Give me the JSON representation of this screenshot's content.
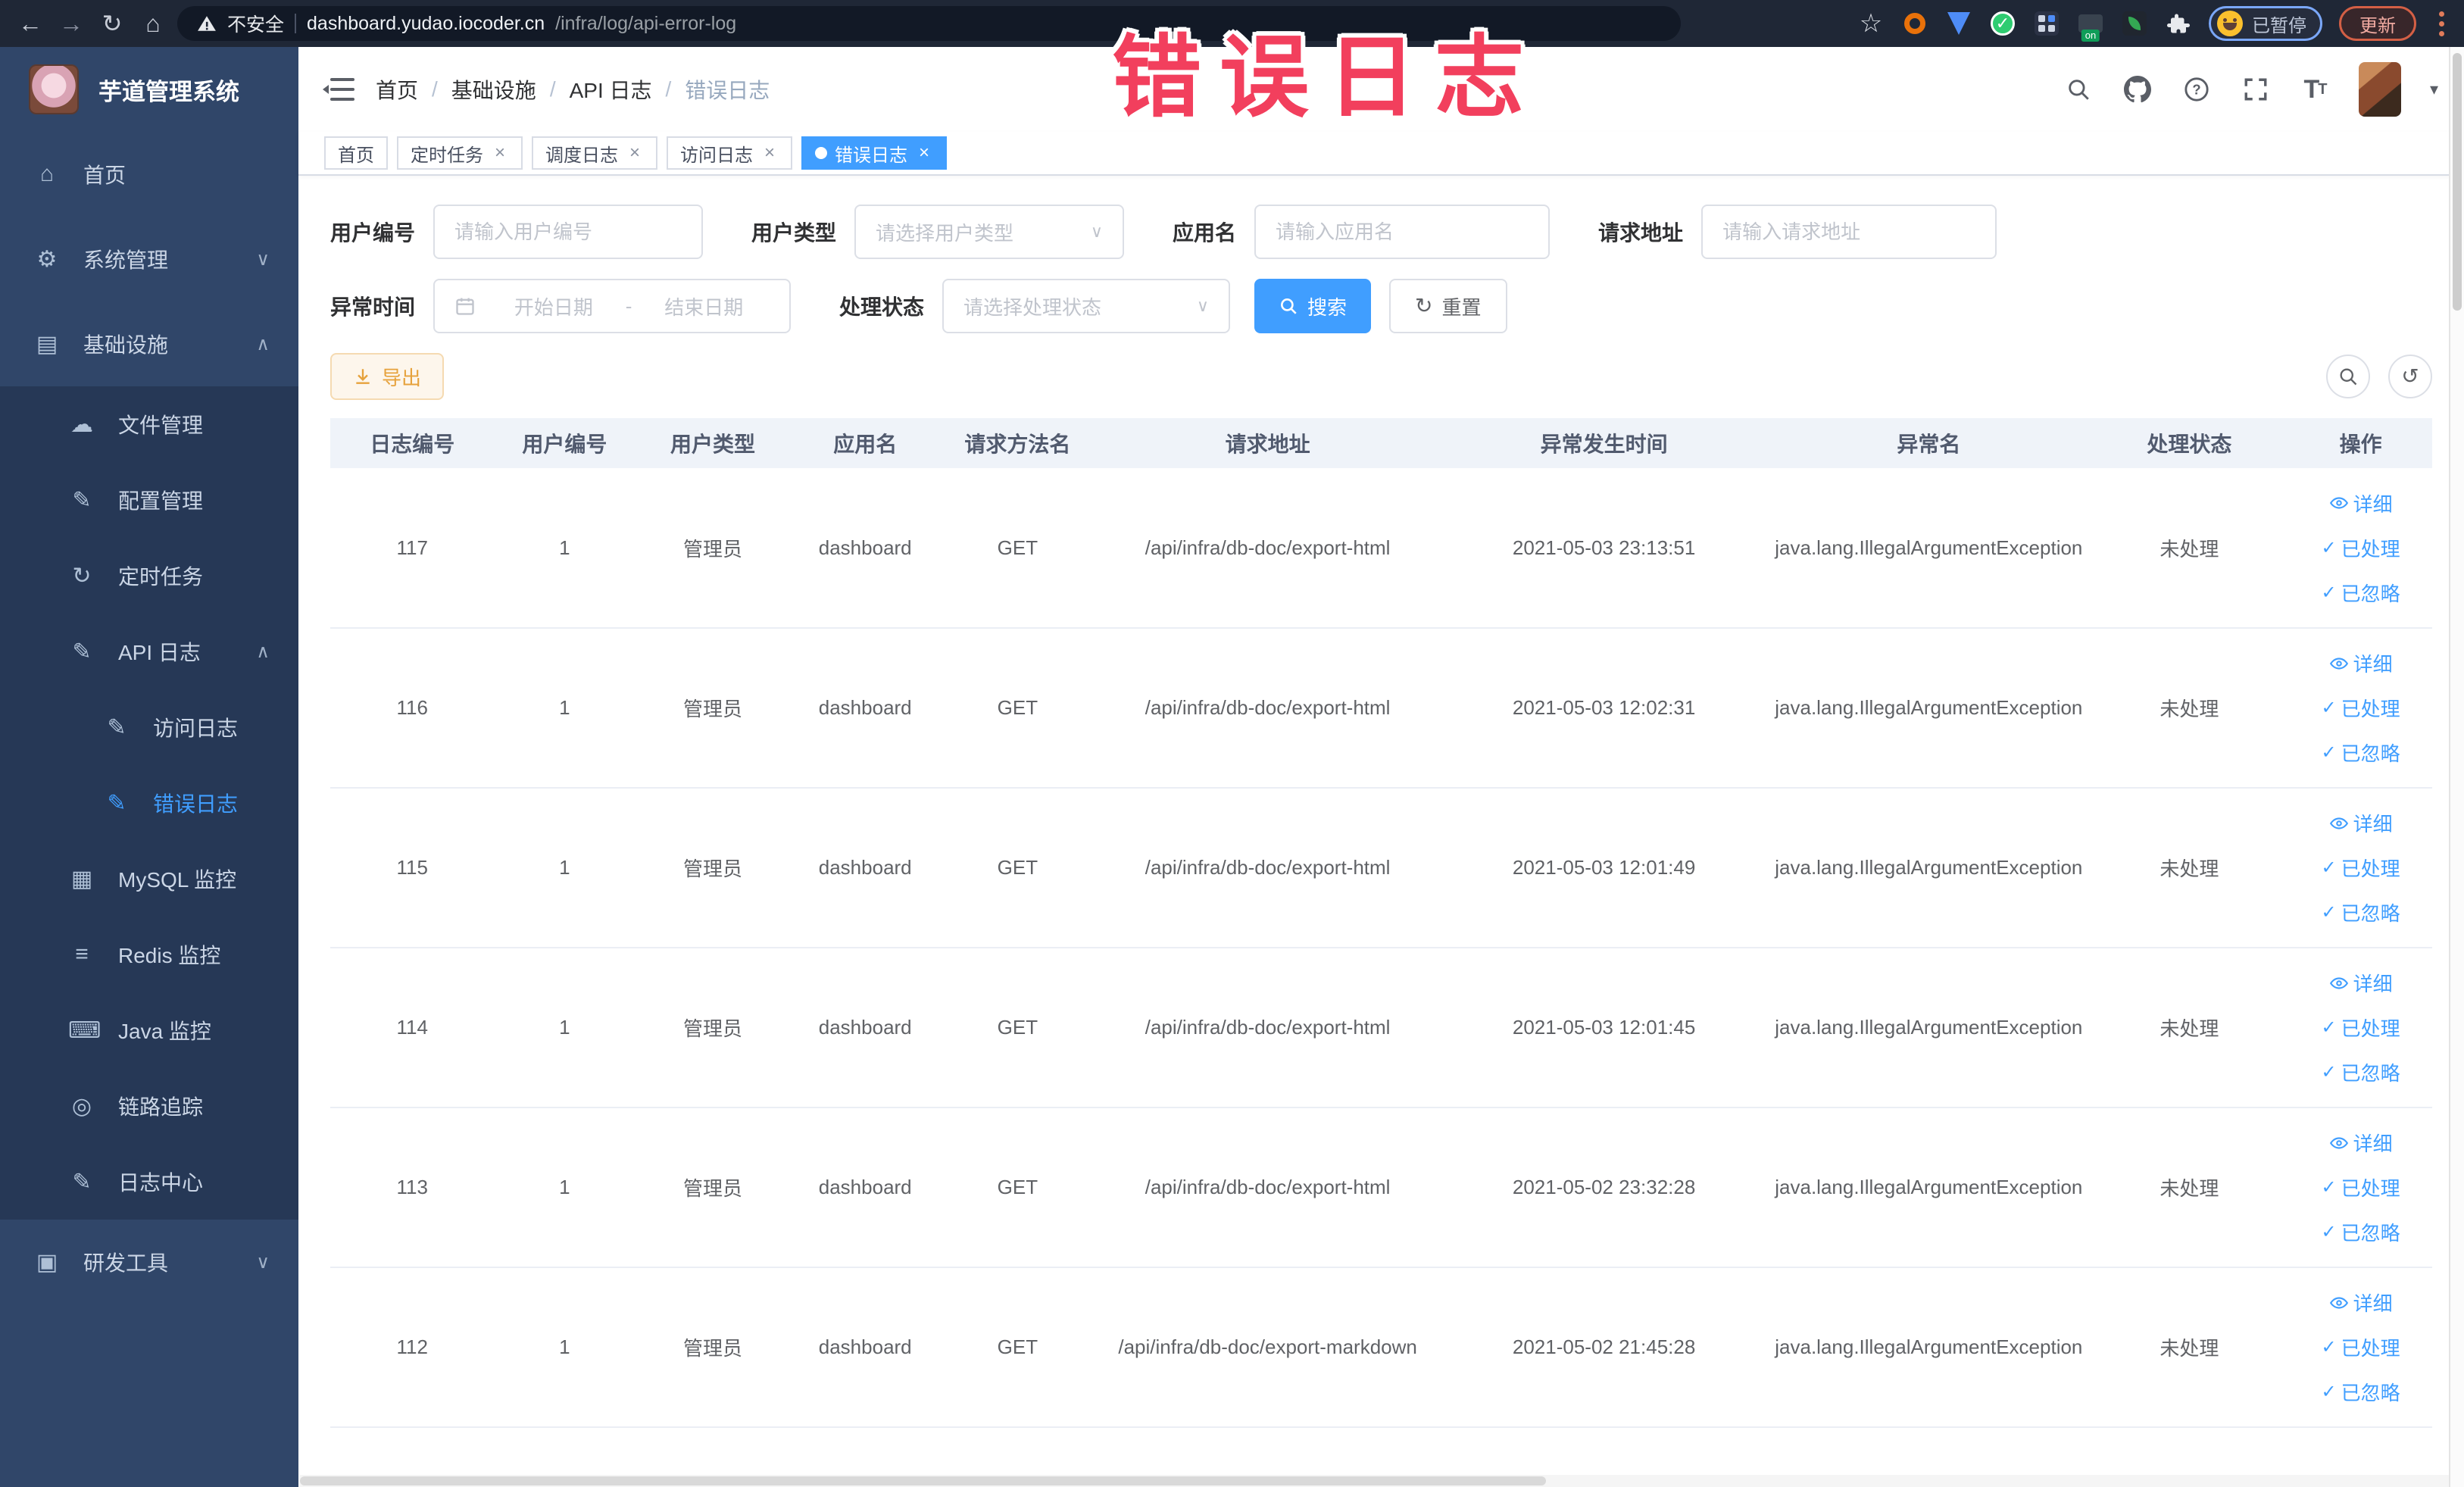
{
  "colors": {
    "accent_blue": "#409eff",
    "warning_orange": "#e6a23c",
    "annotation_red": "#f23f5d",
    "sidebar_bg": "#304669",
    "sidebar_submenu_bg": "#263856",
    "browser_bar_bg": "#1f2736",
    "table_header_bg": "#eff3f9"
  },
  "browser": {
    "security_label": "不安全",
    "url_host": "dashboard.yudao.iocoder.cn",
    "url_path": "/infra/log/api-error-log",
    "paused_badge": "已暂停",
    "update_button": "更新"
  },
  "annotation": {
    "text": "错误日志"
  },
  "sidebar": {
    "title": "芋道管理系统",
    "items": [
      {
        "key": "home",
        "label": "首页",
        "icon": "home-icon",
        "level": 1
      },
      {
        "key": "system",
        "label": "系统管理",
        "icon": "gear-icon",
        "level": 1,
        "chevron": "down"
      },
      {
        "key": "infra",
        "label": "基础设施",
        "icon": "infra-icon",
        "level": 1,
        "chevron": "up"
      },
      {
        "key": "file",
        "label": "文件管理",
        "icon": "upload-icon",
        "level": 2
      },
      {
        "key": "config",
        "label": "配置管理",
        "icon": "edit-icon",
        "level": 2
      },
      {
        "key": "job",
        "label": "定时任务",
        "icon": "timer-icon",
        "level": 2
      },
      {
        "key": "api-log",
        "label": "API 日志",
        "icon": "log-icon",
        "level": 2,
        "chevron": "up"
      },
      {
        "key": "access-log",
        "label": "访问日志",
        "icon": "log-icon",
        "level": 3
      },
      {
        "key": "error-log",
        "label": "错误日志",
        "icon": "log-icon",
        "level": 3,
        "active": true
      },
      {
        "key": "mysql",
        "label": "MySQL 监控",
        "icon": "mysql-icon",
        "level": 2
      },
      {
        "key": "redis",
        "label": "Redis 监控",
        "icon": "redis-icon",
        "level": 2
      },
      {
        "key": "java",
        "label": "Java 监控",
        "icon": "java-icon",
        "level": 2
      },
      {
        "key": "trace",
        "label": "链路追踪",
        "icon": "trace-icon",
        "level": 2
      },
      {
        "key": "log-center",
        "label": "日志中心",
        "icon": "log-icon",
        "level": 2
      },
      {
        "key": "devtools",
        "label": "研发工具",
        "icon": "devtools-icon",
        "level": 1,
        "chevron": "down"
      }
    ]
  },
  "header": {
    "breadcrumb": [
      {
        "key": "home",
        "label": "首页"
      },
      {
        "key": "infra",
        "label": "基础设施"
      },
      {
        "key": "api-log",
        "label": "API 日志"
      },
      {
        "key": "error-log",
        "label": "错误日志",
        "current": true
      }
    ]
  },
  "tabs": [
    {
      "key": "home",
      "label": "首页"
    },
    {
      "key": "job",
      "label": "定时任务",
      "closable": true
    },
    {
      "key": "job-log",
      "label": "调度日志",
      "closable": true
    },
    {
      "key": "access-log",
      "label": "访问日志",
      "closable": true
    },
    {
      "key": "error-log",
      "label": "错误日志",
      "closable": true,
      "active": true
    }
  ],
  "filters": {
    "user_id": {
      "label": "用户编号",
      "placeholder": "请输入用户编号"
    },
    "user_type": {
      "label": "用户类型",
      "placeholder": "请选择用户类型"
    },
    "app_name": {
      "label": "应用名",
      "placeholder": "请输入应用名"
    },
    "request_url": {
      "label": "请求地址",
      "placeholder": "请输入请求地址"
    },
    "exception_time": {
      "label": "异常时间",
      "start_placeholder": "开始日期",
      "separator": "-",
      "end_placeholder": "结束日期"
    },
    "process_status": {
      "label": "处理状态",
      "placeholder": "请选择处理状态"
    },
    "search_button": "搜索",
    "reset_button": "重置"
  },
  "toolbar": {
    "export_button": "导出"
  },
  "table": {
    "columns": [
      "日志编号",
      "用户编号",
      "用户类型",
      "应用名",
      "请求方法名",
      "请求地址",
      "异常发生时间",
      "异常名",
      "处理状态",
      "操作"
    ],
    "row_actions": {
      "detail": "详细",
      "processed": "已处理",
      "ignored": "已忽略"
    },
    "rows": [
      {
        "id": "117",
        "user_id": "1",
        "user_type": "管理员",
        "app": "dashboard",
        "method": "GET",
        "url": "/api/infra/db-doc/export-html",
        "time": "2021-05-03 23:13:51",
        "exception": "java.lang.IllegalArgumentException",
        "status": "未处理"
      },
      {
        "id": "116",
        "user_id": "1",
        "user_type": "管理员",
        "app": "dashboard",
        "method": "GET",
        "url": "/api/infra/db-doc/export-html",
        "time": "2021-05-03 12:02:31",
        "exception": "java.lang.IllegalArgumentException",
        "status": "未处理"
      },
      {
        "id": "115",
        "user_id": "1",
        "user_type": "管理员",
        "app": "dashboard",
        "method": "GET",
        "url": "/api/infra/db-doc/export-html",
        "time": "2021-05-03 12:01:49",
        "exception": "java.lang.IllegalArgumentException",
        "status": "未处理"
      },
      {
        "id": "114",
        "user_id": "1",
        "user_type": "管理员",
        "app": "dashboard",
        "method": "GET",
        "url": "/api/infra/db-doc/export-html",
        "time": "2021-05-03 12:01:45",
        "exception": "java.lang.IllegalArgumentException",
        "status": "未处理"
      },
      {
        "id": "113",
        "user_id": "1",
        "user_type": "管理员",
        "app": "dashboard",
        "method": "GET",
        "url": "/api/infra/db-doc/export-html",
        "time": "2021-05-02 23:32:28",
        "exception": "java.lang.IllegalArgumentException",
        "status": "未处理"
      },
      {
        "id": "112",
        "user_id": "1",
        "user_type": "管理员",
        "app": "dashboard",
        "method": "GET",
        "url": "/api/infra/db-doc/export-markdown",
        "time": "2021-05-02 21:45:28",
        "exception": "java.lang.IllegalArgumentException",
        "status": "未处理"
      }
    ]
  }
}
